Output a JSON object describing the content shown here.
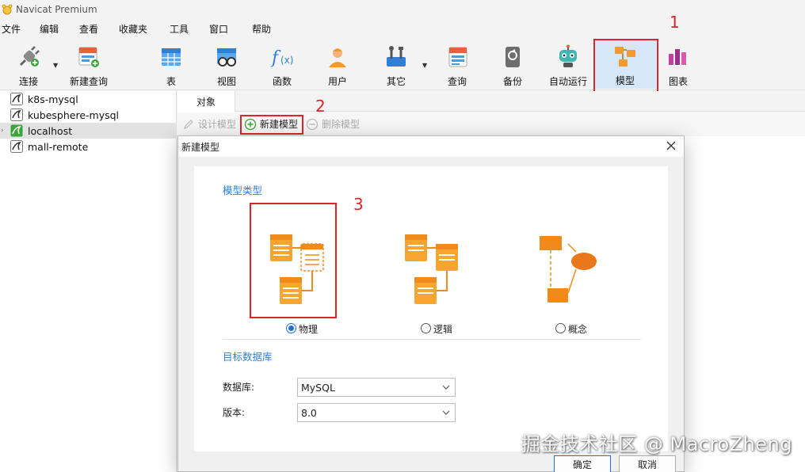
{
  "window": {
    "title": "Navicat Premium"
  },
  "menu": [
    "文件",
    "编辑",
    "查看",
    "收藏夹",
    "工具",
    "窗口",
    "帮助"
  ],
  "toolbar": {
    "items": [
      {
        "label": "连接",
        "icon": "plug-icon"
      },
      {
        "label": "新建查询",
        "icon": "new-query-icon"
      },
      {
        "label": "表",
        "icon": "table-icon"
      },
      {
        "label": "视图",
        "icon": "view-icon"
      },
      {
        "label": "函数",
        "icon": "function-icon"
      },
      {
        "label": "用户",
        "icon": "user-icon"
      },
      {
        "label": "其它",
        "icon": "tools-icon"
      },
      {
        "label": "查询",
        "icon": "query-icon"
      },
      {
        "label": "备份",
        "icon": "backup-icon"
      },
      {
        "label": "自动运行",
        "icon": "robot-icon"
      },
      {
        "label": "模型",
        "icon": "model-icon"
      },
      {
        "label": "图表",
        "icon": "chart-icon"
      }
    ],
    "active": "模型"
  },
  "annotations": [
    "1",
    "2",
    "3"
  ],
  "sidebar": {
    "connections": [
      {
        "label": "k8s-mysql"
      },
      {
        "label": "kubesphere-mysql"
      },
      {
        "label": "localhost"
      },
      {
        "label": "mall-remote"
      }
    ]
  },
  "main": {
    "tab": "对象",
    "actions": [
      {
        "label": "设计模型",
        "enabled": false
      },
      {
        "label": "新建模型",
        "enabled": true
      },
      {
        "label": "删除模型",
        "enabled": false
      }
    ]
  },
  "dialog": {
    "title": "新建模型",
    "model_type_title": "模型类型",
    "model_types": [
      {
        "label": "物理",
        "selected": true
      },
      {
        "label": "逻辑",
        "selected": false
      },
      {
        "label": "概念",
        "selected": false
      }
    ],
    "target_db_title": "目标数据库",
    "database_label": "数据库:",
    "database_value": "MySQL",
    "version_label": "版本:",
    "version_value": "8.0",
    "ok_label": "确定",
    "cancel_label": "取消"
  },
  "watermark": "掘金技术社区 @ MacroZheng",
  "colors": {
    "accent": "#2f7fd6",
    "highlight": "#d9262c",
    "orange": "#f29a2e"
  }
}
